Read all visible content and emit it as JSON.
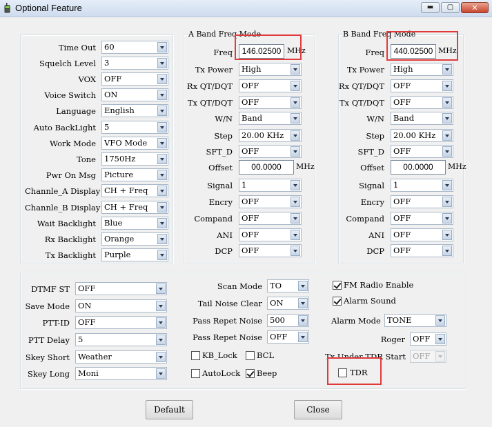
{
  "window": {
    "title": "Optional Feature",
    "controls": {
      "minimize": "▬",
      "maximize": "▢",
      "close": "✕"
    }
  },
  "settings": {
    "rows": [
      {
        "label": "Time Out",
        "value": "60"
      },
      {
        "label": "Squelch Level",
        "value": "3"
      },
      {
        "label": "VOX",
        "value": "OFF"
      },
      {
        "label": "Voice Switch",
        "value": "ON"
      },
      {
        "label": "Language",
        "value": "English"
      },
      {
        "label": "Auto BackLight",
        "value": "5"
      },
      {
        "label": "Work Mode",
        "value": "VFO Mode"
      },
      {
        "label": "Tone",
        "value": "1750Hz"
      },
      {
        "label": "Pwr On Msg",
        "value": "Picture"
      },
      {
        "label": "Channle_A Display",
        "value": "CH + Freq"
      },
      {
        "label": "Channle_B Display",
        "value": "CH + Freq"
      },
      {
        "label": "Wait Backlight",
        "value": "Blue"
      },
      {
        "label": "Rx Backlight",
        "value": "Orange"
      },
      {
        "label": "Tx Backlight",
        "value": "Purple"
      }
    ]
  },
  "band_a": {
    "title": "A Band Freq Mode",
    "freq_label": "Freq",
    "freq_value": "146.02500",
    "freq_unit": "MHz",
    "rows": [
      {
        "label": "Tx Power",
        "value": "High"
      },
      {
        "label": "Rx QT/DQT",
        "value": "OFF"
      },
      {
        "label": "Tx QT/DQT",
        "value": "OFF"
      },
      {
        "label": "W/N",
        "value": "Band"
      },
      {
        "label": "Step",
        "value": "20.00 KHz"
      },
      {
        "label": "SFT_D",
        "value": "OFF"
      }
    ],
    "offset_label": "Offset",
    "offset_value": "00.0000",
    "offset_unit": "MHz",
    "rows2": [
      {
        "label": "Signal",
        "value": "1"
      },
      {
        "label": "Encry",
        "value": "OFF"
      },
      {
        "label": "Compand",
        "value": "OFF"
      },
      {
        "label": "ANI",
        "value": "OFF"
      },
      {
        "label": "DCP",
        "value": "OFF"
      }
    ]
  },
  "band_b": {
    "title": "B Band Freq Mode",
    "freq_label": "Freq",
    "freq_value": "440.02500",
    "freq_unit": "MHz",
    "rows": [
      {
        "label": "Tx Power",
        "value": "High"
      },
      {
        "label": "Rx QT/DQT",
        "value": "OFF"
      },
      {
        "label": "Tx QT/DQT",
        "value": "OFF"
      },
      {
        "label": "W/N",
        "value": "Band"
      },
      {
        "label": "Step",
        "value": "20.00 KHz"
      },
      {
        "label": "SFT_D",
        "value": "OFF"
      }
    ],
    "offset_label": "Offset",
    "offset_value": "00.0000",
    "offset_unit": "MHz",
    "rows2": [
      {
        "label": "Signal",
        "value": "1"
      },
      {
        "label": "Encry",
        "value": "OFF"
      },
      {
        "label": "Compand",
        "value": "OFF"
      },
      {
        "label": "ANI",
        "value": "OFF"
      },
      {
        "label": "DCP",
        "value": "OFF"
      }
    ]
  },
  "dtmf": {
    "rows": [
      {
        "label": "DTMF ST",
        "value": "OFF"
      },
      {
        "label": "Save Mode",
        "value": "ON"
      },
      {
        "label": "PTT-ID",
        "value": "OFF"
      },
      {
        "label": "PTT Delay",
        "value": "5"
      },
      {
        "label": "Skey Short",
        "value": "Weather"
      },
      {
        "label": "Skey Long",
        "value": "Moni"
      }
    ]
  },
  "scan": {
    "rows": [
      {
        "label": "Scan Mode",
        "value": "TO"
      },
      {
        "label": "Tail Noise Clear",
        "value": "ON"
      },
      {
        "label": "Pass Repet Noise",
        "value": "500"
      },
      {
        "label": "Pass Repet Noise",
        "value": "OFF"
      }
    ],
    "checks": [
      {
        "label": "KB_Lock",
        "checked": false
      },
      {
        "label": "BCL",
        "checked": false
      },
      {
        "label": "AutoLock",
        "checked": false
      },
      {
        "label": "Beep",
        "checked": true
      }
    ]
  },
  "radio": {
    "fm_enable": {
      "label": "FM Radio Enable",
      "checked": true
    },
    "alarm_sound": {
      "label": "Alarm Sound",
      "checked": true
    },
    "alarm_mode": {
      "label": "Alarm Mode",
      "value": "TONE"
    },
    "roger": {
      "label": "Roger",
      "value": "OFF"
    },
    "tx_under_tdr": {
      "label": "Tx Under TDR Start",
      "value": "OFF"
    },
    "tdr": {
      "label": "TDR",
      "checked": false
    }
  },
  "buttons": {
    "default_label": "Default",
    "close_label": "Close"
  },
  "colors": {
    "highlight": "#e03a3a",
    "titlebar": "#dbe6f4",
    "background": "#f0f0f0"
  }
}
